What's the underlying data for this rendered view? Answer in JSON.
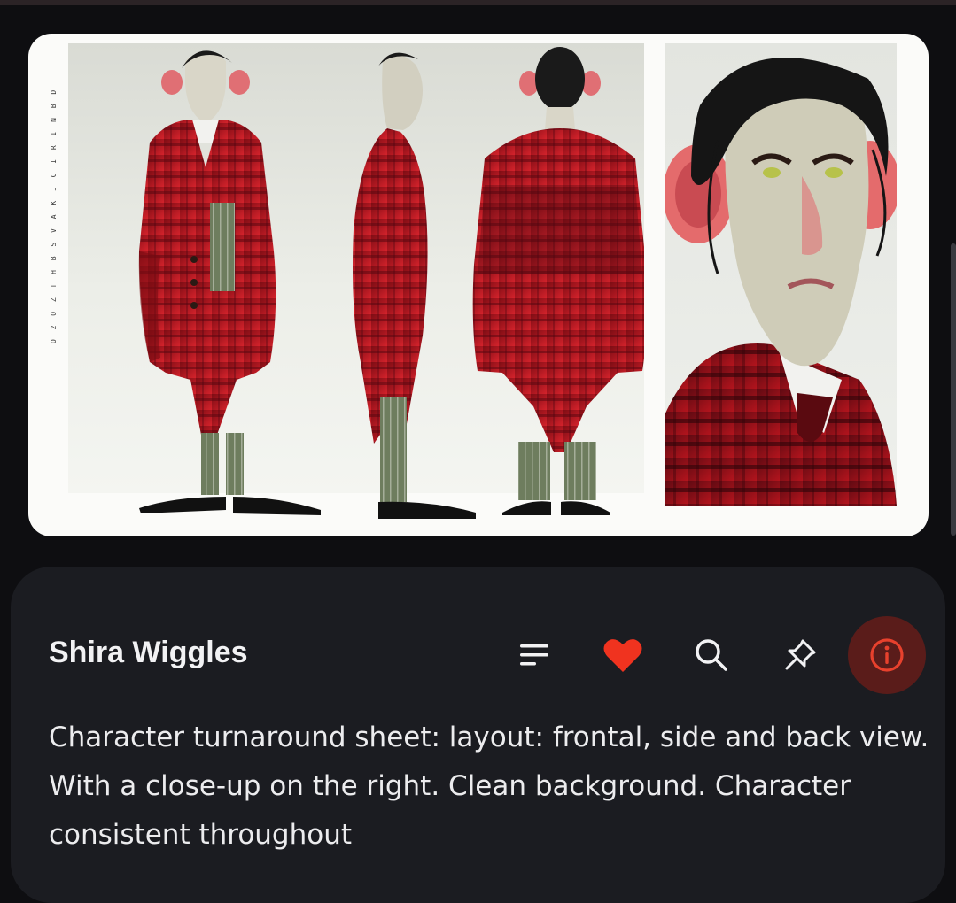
{
  "image": {
    "sheet_vertical_text": "O 2 O Z T H B  S V A K I C I R I N B D",
    "views": [
      "front-view-figure",
      "side-view-figure",
      "back-view-figure",
      "closeup-portrait"
    ]
  },
  "card": {
    "title": "Shira Wiggles",
    "actions": [
      {
        "name": "menu-icon"
      },
      {
        "name": "heart-icon",
        "color": "#f0331f"
      },
      {
        "name": "search-icon"
      },
      {
        "name": "pin-icon"
      },
      {
        "name": "info-icon",
        "color": "#e8412d",
        "active": true
      }
    ],
    "prompt": "Character turnaround sheet: layout: frontal, side and back view. With a close-up on the right. Clean background. Character consistent throughout"
  },
  "colors": {
    "background": "#0e0e11",
    "panel": "#1b1c21",
    "accent": "#e8412d",
    "active_bg": "#5a1c1a"
  }
}
